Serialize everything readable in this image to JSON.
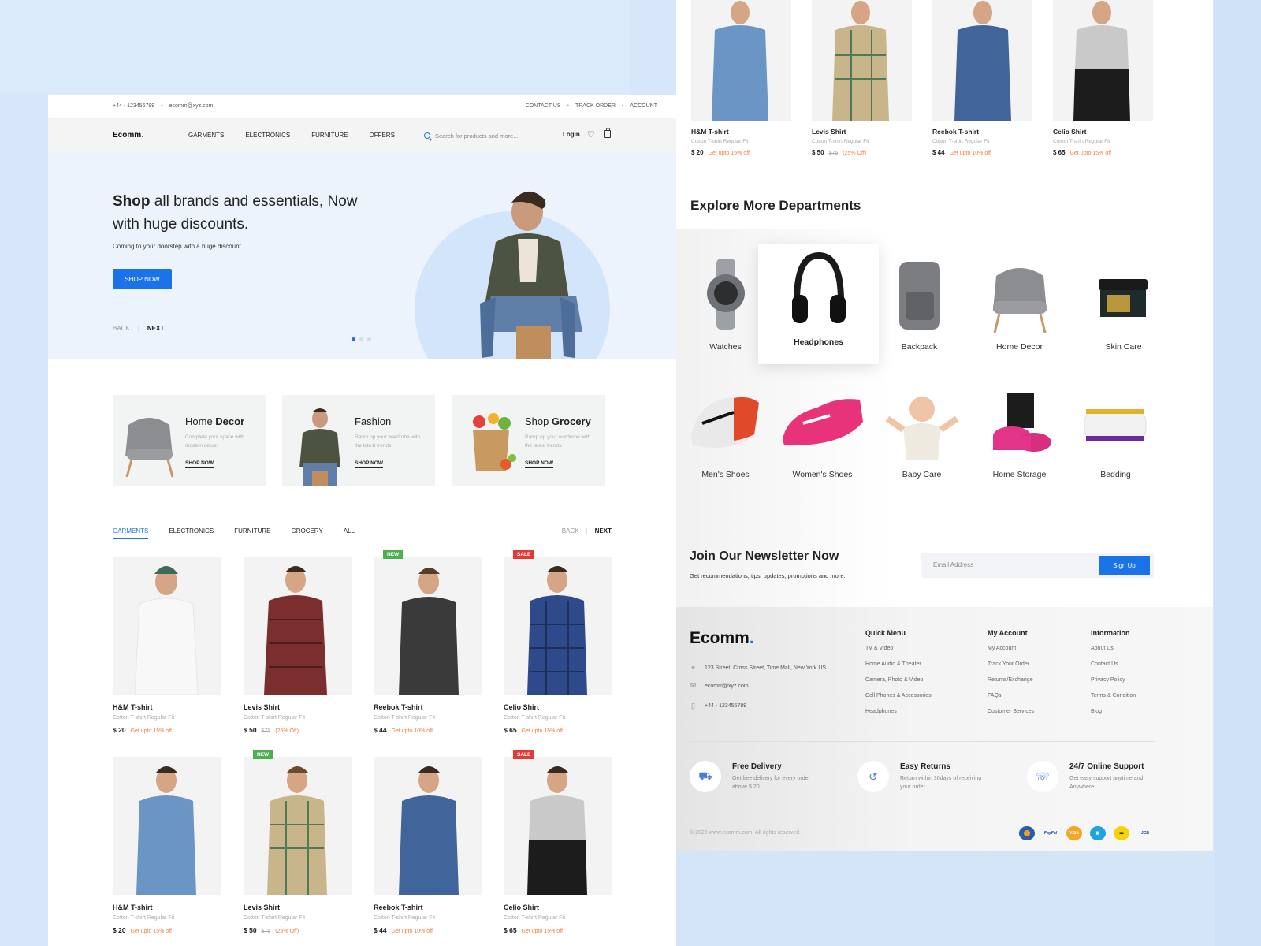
{
  "topbar": {
    "phone": "+44 - 123456789",
    "email": "ecomm@xyz.com",
    "contact": "CONTACT US",
    "track": "TRACK ORDER",
    "account": "ACCOUNT"
  },
  "nav": {
    "logo": "Ecomm",
    "links": [
      "GARMENTS",
      "ELECTRONICS",
      "FURNITURE",
      "OFFERS"
    ],
    "search_placeholder": "Search for products and more...",
    "login": "Login"
  },
  "hero": {
    "title_bold": "Shop",
    "title_rest": " all brands and essentials, Now with huge discounts.",
    "subtitle": "Coming to your doorstep with a huge discount.",
    "cta": "SHOP NOW",
    "back": "BACK",
    "next": "NEXT",
    "slide_count": 3,
    "active_slide": 1
  },
  "categories": [
    {
      "title_light": "Home ",
      "title_bold": "Decor",
      "desc": "Complete your space with modern decor.",
      "link": "SHOP NOW"
    },
    {
      "title_light": "Fashion",
      "title_bold": "",
      "desc": "Ramp up your wardrobe with the latest trends.",
      "link": "SHOP NOW"
    },
    {
      "title_light": "Shop ",
      "title_bold": "Grocery",
      "desc": "Ramp up your wardrobe with the latest trends.",
      "link": "SHOP NOW"
    }
  ],
  "tabs": {
    "items": [
      "GARMENTS",
      "ELECTRONICS",
      "FURNITURE",
      "GROCERY",
      "ALL"
    ],
    "active": "GARMENTS",
    "back": "BACK",
    "next": "NEXT"
  },
  "products": [
    {
      "name": "H&M T-shirt",
      "desc": "Cotton T-shirt Regular Fit",
      "price": "$ 20",
      "old": "",
      "offer": "Get upto 15% off",
      "badge": ""
    },
    {
      "name": "Levis Shirt",
      "desc": "Cotton T-shirt Regular Fit",
      "price": "$ 50",
      "old": "$75",
      "offer": "(25% Off)",
      "badge": ""
    },
    {
      "name": "Reebok T-shirt",
      "desc": "Cotton T-shirt Regular Fit",
      "price": "$ 44",
      "old": "",
      "offer": "Get upto 10% off",
      "badge": "NEW"
    },
    {
      "name": "Celio Shirt",
      "desc": "Cotton T-shirt Regular Fit",
      "price": "$ 65",
      "old": "",
      "offer": "Get upto 15% off",
      "badge": "SALE"
    },
    {
      "name": "H&M T-shirt",
      "desc": "Cotton T-shirt Regular Fit",
      "price": "$ 20",
      "old": "",
      "offer": "Get upto 15% off",
      "badge": ""
    },
    {
      "name": "Levis Shirt",
      "desc": "Cotton T-shirt Regular Fit",
      "price": "$ 50",
      "old": "$75",
      "offer": "(25% Off)",
      "badge": "NEW"
    },
    {
      "name": "Reebok T-shirt",
      "desc": "Cotton T-shirt Regular Fit",
      "price": "$ 44",
      "old": "",
      "offer": "Get upto 10% off",
      "badge": ""
    },
    {
      "name": "Celio Shirt",
      "desc": "Cotton T-shirt Regular Fit",
      "price": "$ 65",
      "old": "",
      "offer": "Get upto 15% off",
      "badge": "SALE"
    }
  ],
  "departments": {
    "title": "Explore More Departments",
    "row1": [
      "Watches",
      "Headphones",
      "Backpack",
      "Home Decor",
      "Skin Care"
    ],
    "row2": [
      "Men's Shoes",
      "Women's Shoes",
      "Baby Care",
      "Home Storage",
      "Bedding"
    ],
    "active": "Headphones"
  },
  "newsletter": {
    "title": "Join Our Newsletter Now",
    "subtitle": "Get recommendations, tips, updates, promotions and more.",
    "placeholder": "Email Address",
    "button": "Sign Up"
  },
  "footer": {
    "logo": "Ecomm",
    "address": "123 Street, Cross Street, Time Mall, New York US",
    "email": "ecomm@xyz.com",
    "phone": "+44 - 123456789",
    "columns": [
      {
        "title": "Quick Menu",
        "items": [
          "TV & Video",
          "Home Audio & Theater",
          "Camera, Photo & Video",
          "Cell Phones & Accessories",
          "Headphones"
        ]
      },
      {
        "title": "My Account",
        "items": [
          "My Account",
          "Track Your Order",
          "Returns/Exchange",
          "FAQs",
          "Customer Services"
        ]
      },
      {
        "title": "Information",
        "items": [
          "About Us",
          "Contact Us",
          "Privacy Policy",
          "Terms & Condition",
          "Blog"
        ]
      }
    ],
    "features": [
      {
        "title": "Free Delivery",
        "desc": "Get free delivery for every order above $ 20."
      },
      {
        "title": "Easy Returns",
        "desc": "Return within 30days of receiving your order."
      },
      {
        "title": "24/7 Online Support",
        "desc": "Get easy support anytime and Anywhere."
      }
    ],
    "copyright": "© 2020 www.ecomm.com. All rights reserved.",
    "payments": [
      "mastercard",
      "PayPal",
      "VISA",
      "amex",
      "discover",
      "JCB"
    ]
  },
  "colors": {
    "accent": "#1a73e8",
    "offer": "#f57c3b",
    "new_badge": "#4caf50",
    "sale_badge": "#e53935"
  }
}
